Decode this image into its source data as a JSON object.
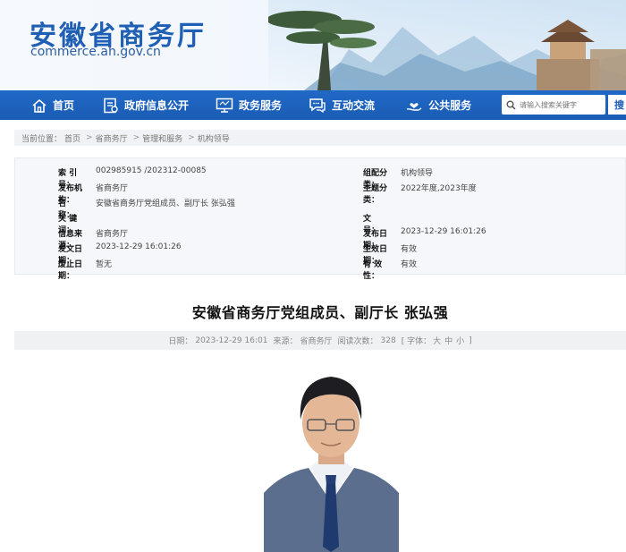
{
  "header": {
    "site_title": "安徽省商务厅",
    "site_url": "commerce.ah.gov.cn"
  },
  "nav": {
    "items": [
      {
        "label": "首页",
        "icon": "home-icon"
      },
      {
        "label": "政府信息公开",
        "icon": "document-icon"
      },
      {
        "label": "政务服务",
        "icon": "monitor-icon"
      },
      {
        "label": "互动交流",
        "icon": "chat-icon"
      },
      {
        "label": "公共服务",
        "icon": "heart-hand-icon"
      }
    ],
    "search_placeholder": "请输入搜索关键字",
    "search_button": "搜"
  },
  "breadcrumb": {
    "prefix": "当前位置：",
    "items": [
      "首页",
      "省商务厅",
      "管理和服务",
      "机构领导"
    ],
    "separator": ">"
  },
  "meta": {
    "index_no": {
      "label": "索 引 号：",
      "value": "002985915 /202312-00085"
    },
    "category": {
      "label": "组配分类：",
      "value": "机构领导"
    },
    "publisher": {
      "label": "发布机构：",
      "value": "省商务厅"
    },
    "topic": {
      "label": "主题分类：",
      "value": "2022年度,2023年度"
    },
    "name": {
      "label": "名　　称：",
      "value": "安徽省商务厅党组成员、副厅长 张弘强"
    },
    "keywords": {
      "label": "关 键 词：",
      "value": ""
    },
    "doc_no": {
      "label": "文　　号：",
      "value": ""
    },
    "source": {
      "label": "信息来源：",
      "value": "省商务厅"
    },
    "pub_date": {
      "label": "发布日期：",
      "value": "2023-12-29 16:01:26"
    },
    "issue_date": {
      "label": "发文日期：",
      "value": "2023-12-29 16:01:26"
    },
    "effective_date": {
      "label": "生效日期：",
      "value": "有效"
    },
    "expire_date": {
      "label": "废止日期：",
      "value": "暂无"
    },
    "validity": {
      "label": "有 效 性：",
      "value": "有效"
    }
  },
  "article": {
    "title": "安徽省商务厅党组成员、副厅长 张弘强",
    "date_label": "日期：",
    "date": "2023-12-29 16:01",
    "source_label": "来源：",
    "source": "省商务厅",
    "views_label": "阅读次数：",
    "views": "328",
    "font_prefix": "[ 字体：",
    "font_large": "大",
    "font_medium": "中",
    "font_small": "小",
    "font_suffix": "]"
  }
}
